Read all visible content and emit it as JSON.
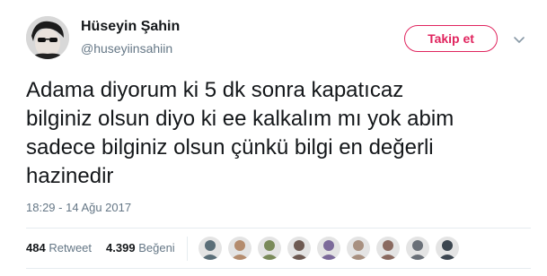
{
  "author": {
    "display_name": "Hüseyin Şahin",
    "handle": "@huseyiinsahiin"
  },
  "follow_button": "Takip et",
  "tweet": {
    "text": "Adama diyorum ki 5 dk sonra kapatıcaz\nbilginiz olsun diyo ki ee kalkalım mı yok abim\nsadece bilginiz olsun çünkü bilgi en değerli\nhazinedir",
    "timestamp": "18:29 - 14 Ağu 2017"
  },
  "stats": {
    "retweets_count": "484",
    "retweets_label": "Retweet",
    "likes_count": "4.399",
    "likes_label": "Beğeni"
  },
  "likers": [
    {
      "color": "#5a6e78"
    },
    {
      "color": "#b48c6e"
    },
    {
      "color": "#7a8a5a"
    },
    {
      "color": "#6e5a52"
    },
    {
      "color": "#7c6a9a"
    },
    {
      "color": "#a89080"
    },
    {
      "color": "#8a6a60"
    },
    {
      "color": "#6a7078"
    },
    {
      "color": "#3c4650"
    }
  ],
  "colors": {
    "accent": "#e0245e",
    "secondary_text": "#657786",
    "primary_text": "#14171a"
  }
}
